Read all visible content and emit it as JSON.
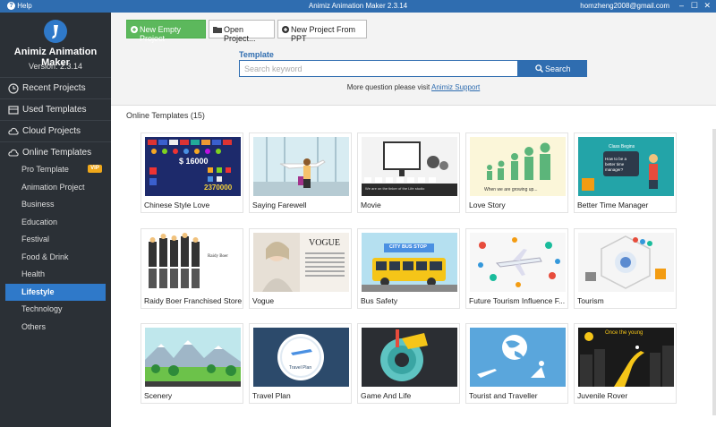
{
  "titlebar": {
    "help": "Help",
    "title": "Animiz Animation Maker 2.3.14",
    "user": "homzheng2008@gmail.com",
    "minimize": "–",
    "maximize": "☐",
    "close": "✕"
  },
  "sidebar": {
    "brand": "Animiz Animation Maker",
    "version": "Version: 2.3.14",
    "main_items": [
      {
        "label": "Recent Projects",
        "icon": "clock-icon"
      },
      {
        "label": "Used Templates",
        "icon": "template-icon"
      },
      {
        "label": "Cloud Projects",
        "icon": "cloud-icon"
      },
      {
        "label": "Online Templates",
        "icon": "cloud-icon"
      }
    ],
    "sub_items": [
      {
        "label": "Pro Template",
        "badge": "VIP"
      },
      {
        "label": "Animation Project"
      },
      {
        "label": "Business"
      },
      {
        "label": "Education"
      },
      {
        "label": "Festival"
      },
      {
        "label": "Food & Drink"
      },
      {
        "label": "Health"
      },
      {
        "label": "Lifestyle",
        "active": true
      },
      {
        "label": "Technology"
      },
      {
        "label": "Others"
      }
    ]
  },
  "toolbar": {
    "new_empty": "New Empty Project",
    "open": "Open Project...",
    "new_ppt": "New Project From PPT"
  },
  "search": {
    "label": "Template",
    "placeholder": "Search keyword",
    "button": "Search",
    "support_prefix": "More question please visit",
    "support_link": "Animiz Support"
  },
  "templates": {
    "title": "Online Templates (15)",
    "items": [
      {
        "name": "Chinese Style Love",
        "thumb_text": "$ 16000",
        "thumb_text2": "2370000"
      },
      {
        "name": "Saying Farewell"
      },
      {
        "name": "Movie",
        "thumb_text": "We are on the tinker of the Life studio"
      },
      {
        "name": "Love Story",
        "thumb_text": "When we are growing up..."
      },
      {
        "name": "Better Time Manager",
        "thumb_text": "Class Begins",
        "thumb_text2": "How to be a better time manager?"
      },
      {
        "name": "Raidy Boer Franchised Store",
        "thumb_text": "Raidy Boer"
      },
      {
        "name": "Vogue",
        "thumb_text": "VOGUE"
      },
      {
        "name": "Bus Safety",
        "thumb_text": "CITY BUS STOP"
      },
      {
        "name": "Future Tourism Influence F..."
      },
      {
        "name": "Tourism"
      },
      {
        "name": "Scenery"
      },
      {
        "name": "Travel Plan",
        "thumb_text": "Travel Plan"
      },
      {
        "name": "Game And Life"
      },
      {
        "name": "Tourist and Traveller"
      },
      {
        "name": "Juvenile Rover",
        "thumb_text": "Once the young"
      }
    ]
  }
}
